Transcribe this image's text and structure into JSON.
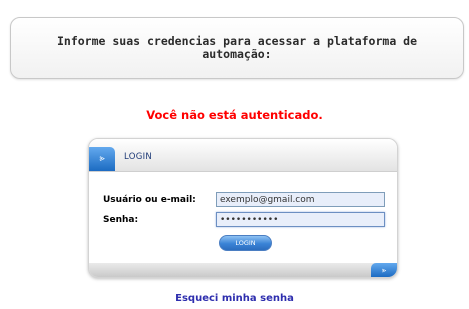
{
  "banner": {
    "text": "Informe suas credencias para acessar a plataforma de automação:"
  },
  "auth_message": "Você não está autenticado.",
  "login": {
    "title": "LOGIN",
    "user_label": "Usuário ou e-mail:",
    "user_value": "exemplo@gmail.com",
    "password_label": "Senha:",
    "password_value": "•••••••••••",
    "button_label": "LOGIN"
  },
  "forgot_link": "Esqueci minha senha",
  "icons": {
    "header": "double-chevron-icon",
    "footer": "double-chevron-icon"
  },
  "colors": {
    "error": "#ff0000",
    "accent": "#2a7bd4",
    "link": "#2e2eae"
  }
}
